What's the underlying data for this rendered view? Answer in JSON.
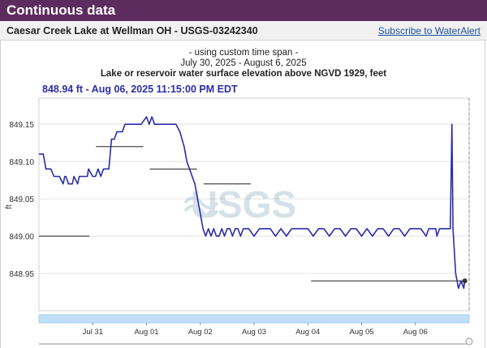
{
  "header": {
    "title": "Continuous data",
    "site_title": "Caesar Creek Lake at Wellman OH - USGS-03242340",
    "subscribe_link": "Subscribe to WaterAlert"
  },
  "colors": {
    "header_bg": "#5d2c5f",
    "series": "#2b2ea8",
    "tooltip_text": "#2b2ea8",
    "brush": "#bfe0f7"
  },
  "watermark": "USGS",
  "chart_data": {
    "type": "line",
    "title_lines": [
      "- using custom time span -",
      "July 30, 2025 - August 6, 2025",
      "Lake or reservoir water surface elevation above NGVD 1929, feet"
    ],
    "tooltip": "848.94 ft - Aug 06, 2025 11:15:00 PM EDT",
    "ylabel": "ft",
    "xlabel": "",
    "ylim": [
      848.9,
      849.185
    ],
    "xlim": [
      0,
      8.0
    ],
    "x_ticks": [
      {
        "label": "Jul 31",
        "x": 1.0
      },
      {
        "label": "Aug 01",
        "x": 2.0
      },
      {
        "label": "Aug 02",
        "x": 3.0
      },
      {
        "label": "Aug 03",
        "x": 4.0
      },
      {
        "label": "Aug 04",
        "x": 5.0
      },
      {
        "label": "Aug 05",
        "x": 6.0
      },
      {
        "label": "Aug 06",
        "x": 7.0
      }
    ],
    "y_ticks": [
      848.95,
      849.0,
      849.05,
      849.1,
      849.15
    ],
    "y_tick_labels": [
      "848.95",
      "849.00",
      "849.05",
      "849.10",
      "849.15"
    ],
    "grid": true,
    "daily_means": [
      {
        "x0": 0.0,
        "x1": 1.0,
        "y": 849.0
      },
      {
        "x0": 1.0,
        "x1": 2.0,
        "y": 849.12
      },
      {
        "x0": 2.0,
        "x1": 3.0,
        "y": 849.09
      },
      {
        "x0": 3.0,
        "x1": 4.0,
        "y": 849.07
      },
      {
        "x0": 5.0,
        "x1": 8.0,
        "y": 848.94
      }
    ],
    "series": [
      {
        "x": [
          0.0,
          0.08,
          0.13,
          0.22,
          0.28,
          0.35,
          0.38,
          0.45,
          0.48,
          0.5,
          0.55,
          0.62,
          0.65,
          0.72,
          0.75,
          0.8,
          0.9,
          0.92,
          1.0,
          1.05,
          1.1,
          1.15,
          1.2,
          1.25,
          1.3,
          1.35,
          1.4,
          1.45,
          1.5,
          1.55,
          1.6,
          1.65,
          1.7,
          1.8,
          1.9,
          2.0,
          2.05,
          2.1,
          2.15,
          2.2,
          2.25,
          2.3,
          2.35,
          2.45,
          2.55,
          2.62,
          2.7,
          2.75,
          2.8,
          2.9,
          2.95,
          3.0,
          3.05,
          3.1,
          3.15,
          3.2,
          3.25,
          3.3,
          3.35,
          3.4,
          3.45,
          3.5,
          3.55,
          3.6,
          3.65,
          3.7,
          3.75,
          3.8,
          3.9,
          4.0,
          4.1,
          4.2,
          4.3,
          4.4,
          4.5,
          4.6,
          4.7,
          4.8,
          4.9,
          5.0,
          5.1,
          5.2,
          5.3,
          5.4,
          5.5,
          5.6,
          5.7,
          5.8,
          5.9,
          6.0,
          6.1,
          6.2,
          6.3,
          6.4,
          6.5,
          6.6,
          6.7,
          6.8,
          6.9,
          7.0,
          7.1,
          7.2,
          7.25,
          7.3,
          7.35,
          7.38,
          7.4,
          7.45,
          7.5,
          7.55,
          7.6,
          7.62,
          7.65,
          7.68,
          7.7,
          7.75,
          7.8,
          7.85,
          7.9,
          7.92
        ],
        "y": [
          849.11,
          849.11,
          849.09,
          849.09,
          849.08,
          849.08,
          849.08,
          849.07,
          849.08,
          849.08,
          849.07,
          849.07,
          849.08,
          849.07,
          849.08,
          849.08,
          849.08,
          849.09,
          849.08,
          849.08,
          849.09,
          849.08,
          849.09,
          849.09,
          849.09,
          849.13,
          849.13,
          849.14,
          849.14,
          849.14,
          849.15,
          849.15,
          849.15,
          849.15,
          849.15,
          849.16,
          849.15,
          849.16,
          849.15,
          849.15,
          849.15,
          849.15,
          849.15,
          849.15,
          849.15,
          849.14,
          849.12,
          849.1,
          849.09,
          849.07,
          849.05,
          849.03,
          849.01,
          849.0,
          849.01,
          849.0,
          849.01,
          849.0,
          849.0,
          849.01,
          849.0,
          849.01,
          849.01,
          849.0,
          849.01,
          849.01,
          849.0,
          849.01,
          849.01,
          849.0,
          849.01,
          849.01,
          849.01,
          849.0,
          849.01,
          849.0,
          849.01,
          849.01,
          849.01,
          849.01,
          849.0,
          849.01,
          849.01,
          849.0,
          849.01,
          849.01,
          849.0,
          849.01,
          849.01,
          849.0,
          849.01,
          849.0,
          849.01,
          849.01,
          849.0,
          849.01,
          849.01,
          849.0,
          849.01,
          849.01,
          849.01,
          849.0,
          849.01,
          849.01,
          849.01,
          849.01,
          849.0,
          849.01,
          849.01,
          849.01,
          849.01,
          849.01,
          849.01,
          849.15,
          849.01,
          848.95,
          848.93,
          848.94,
          848.93,
          848.94
        ]
      }
    ]
  }
}
